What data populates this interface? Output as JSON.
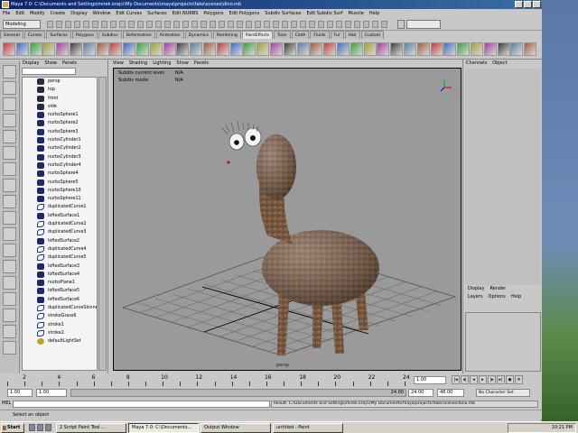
{
  "window": {
    "title": "Maya 7.0: C:\\Documents and Settings\\mirek.krejci\\My Documents\\maya\\projects\\fake\\scenes\\dino.mb"
  },
  "menubar": [
    "File",
    "Edit",
    "Modify",
    "Create",
    "Display",
    "Window",
    "Edit Curves",
    "Surfaces",
    "Edit NURBS",
    "Polygons",
    "Edit Polygons",
    "Subdiv Surfaces",
    "Edit Subdiv Surf",
    "Muscle",
    "Help"
  ],
  "statusline": {
    "mode": "Modeling",
    "field_label": "▼"
  },
  "shelf_tabs": [
    "General",
    "Curves",
    "Surfaces",
    "Polygons",
    "Subdivs",
    "Deformation",
    "Animation",
    "Dynamics",
    "Rendering",
    "PaintEffects",
    "Toon",
    "Cloth",
    "Fluids",
    "Fur",
    "Hair",
    "Custom"
  ],
  "active_shelf_tab": "PaintEffects",
  "outliner": {
    "menu": [
      "Display",
      "Show",
      "Panels"
    ],
    "items": [
      {
        "label": "persp",
        "icon": "camera"
      },
      {
        "label": "top",
        "icon": "camera"
      },
      {
        "label": "front",
        "icon": "camera"
      },
      {
        "label": "side",
        "icon": "camera"
      },
      {
        "label": "nurbsSphere1",
        "icon": "shape"
      },
      {
        "label": "nurbsSphere2",
        "icon": "shape"
      },
      {
        "label": "nurbsSphere3",
        "icon": "shape"
      },
      {
        "label": "nurbsCylinder1",
        "icon": "shape"
      },
      {
        "label": "nurbsCylinder2",
        "icon": "shape"
      },
      {
        "label": "nurbsCylinder3",
        "icon": "shape"
      },
      {
        "label": "nurbsCylinder4",
        "icon": "shape"
      },
      {
        "label": "nurbsSphere4",
        "icon": "shape"
      },
      {
        "label": "nurbsSphere5",
        "icon": "shape"
      },
      {
        "label": "nurbsSphere10",
        "icon": "shape"
      },
      {
        "label": "nurbsSphere11",
        "icon": "shape"
      },
      {
        "label": "duplicatedCurve1",
        "icon": "curve"
      },
      {
        "label": "loftedSurface1",
        "icon": "shape"
      },
      {
        "label": "duplicatedCurve2",
        "icon": "curve"
      },
      {
        "label": "duplicatedCurve3",
        "icon": "curve"
      },
      {
        "label": "loftedSurface2",
        "icon": "shape"
      },
      {
        "label": "duplicatedCurve4",
        "icon": "curve"
      },
      {
        "label": "duplicatedCurve5",
        "icon": "curve"
      },
      {
        "label": "loftedSurface3",
        "icon": "shape"
      },
      {
        "label": "loftedSurface4",
        "icon": "shape"
      },
      {
        "label": "nurbsPlane1",
        "icon": "shape"
      },
      {
        "label": "loftedSurface5",
        "icon": "shape"
      },
      {
        "label": "loftedSurface6",
        "icon": "shape"
      },
      {
        "label": "duplicatedCurveSkinnedSurface",
        "icon": "curve"
      },
      {
        "label": "strokeGrass6",
        "icon": "curve"
      },
      {
        "label": "stroke1",
        "icon": "curve"
      },
      {
        "label": "stroke2",
        "icon": "curve"
      },
      {
        "label": "defaultLightSet",
        "icon": "light"
      }
    ]
  },
  "viewport": {
    "menu": [
      "View",
      "Shading",
      "Lighting",
      "Show",
      "Panels"
    ],
    "hud": [
      {
        "label": "Subdiv current level:",
        "value": "N/A"
      },
      {
        "label": "Subdiv mode:",
        "value": "N/A"
      }
    ],
    "camera_label": "persp"
  },
  "channel_box": {
    "menu": [
      "Channels",
      "Object"
    ],
    "layer_tabs": [
      "Display",
      "Render"
    ],
    "layer_menu": [
      "Layers",
      "Options",
      "Help"
    ]
  },
  "time_slider": {
    "ticks": [
      "2",
      "4",
      "6",
      "8",
      "10",
      "12",
      "14",
      "16",
      "18",
      "20",
      "22",
      "24"
    ],
    "current_frame": "1.00"
  },
  "range_slider": {
    "start": "1.00",
    "inner_start": "1.00",
    "inner_end": "24.00",
    "end": "24.00",
    "anim_end": "48.00",
    "character_set": "No Character Set"
  },
  "command_line": {
    "label": "MEL",
    "result": "Result: C:/Documents and Settings/mirek.krejci/My Documents/maya/projects/fake/scenes/dino.mb"
  },
  "help_line": "Select an object",
  "taskbar": {
    "start_label": "Start",
    "tasks": [
      {
        "label": "2 Script Paint Tool ..."
      },
      {
        "label": "Maya 7.0: C:\\Documents..."
      },
      {
        "label": "Output Window"
      },
      {
        "label": "untitled - Paint"
      }
    ],
    "clock": "10:21 PM"
  }
}
